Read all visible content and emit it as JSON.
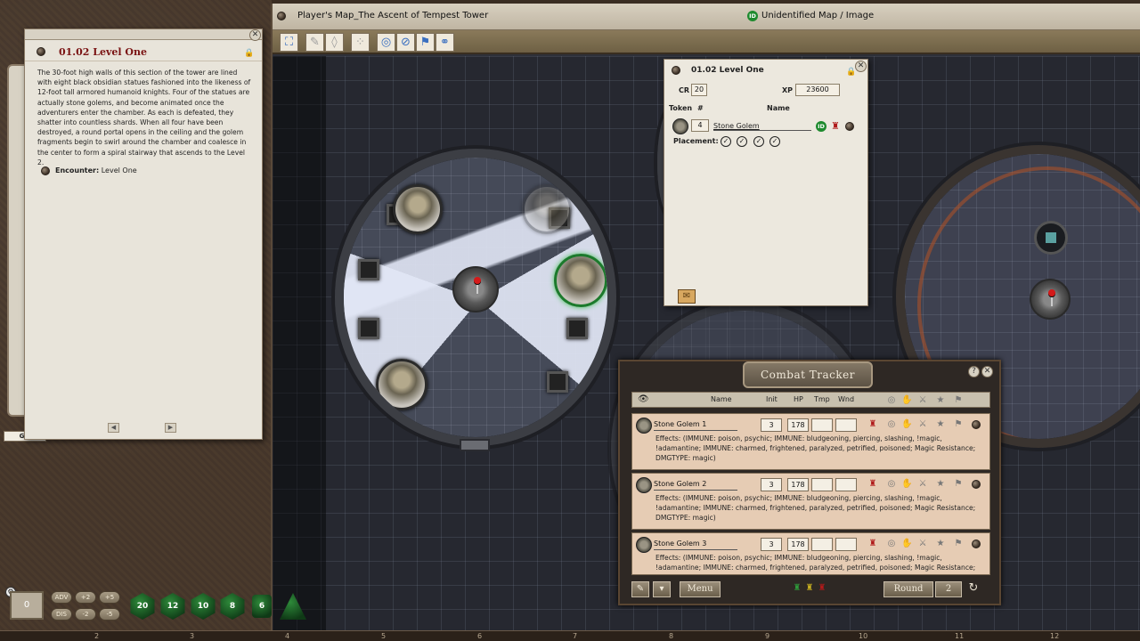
{
  "map_window": {
    "title": "Player's Map_The Ascent of Tempest Tower",
    "status": "Unidentified Map / Image"
  },
  "story": {
    "title": "01.02 Level One",
    "body": "The 30-foot high walls of this section of the tower are lined with eight black obsidian statues fashioned into the likeness of 12-foot tall armored humanoid knights. Four of the statues are actually stone golems, and become animated once the adventurers enter the chamber. As each is defeated, they shatter into countless shards. When all four have been destroyed, a round portal opens in the ceiling and the golem fragments begin to swirl around the chamber and coalesce in the center to form a spiral stairway that ascends to the Level 2.",
    "link_label": "Encounter:",
    "link_value": "Level One"
  },
  "side_tab": "GM",
  "encounter": {
    "title": "01.02 Level One",
    "cr_label": "CR",
    "cr": "20",
    "xp_label": "XP",
    "xp": "23600",
    "token_header": "Token",
    "count_header": "#",
    "name_header": "Name",
    "count": "4",
    "name": "Stone Golem",
    "placement_label": "Placement:"
  },
  "combat_tracker": {
    "title": "Combat Tracker",
    "headers": {
      "name": "Name",
      "init": "Init",
      "hp": "HP",
      "tmp": "Tmp",
      "wnd": "Wnd"
    },
    "rows": [
      {
        "name": "Stone Golem 1",
        "init": "3",
        "hp": "178",
        "effects": "Effects: (IMMUNE: poison, psychic; IMMUNE: bludgeoning, piercing, slashing, !magic, !adamantine; IMMUNE: charmed, frightened, paralyzed, petrified, poisoned; Magic Resistance; DMGTYPE: magic)"
      },
      {
        "name": "Stone Golem 2",
        "init": "3",
        "hp": "178",
        "effects": "Effects: (IMMUNE: poison, psychic; IMMUNE: bludgeoning, piercing, slashing, !magic, !adamantine; IMMUNE: charmed, frightened, paralyzed, petrified, poisoned; Magic Resistance; DMGTYPE: magic)"
      },
      {
        "name": "Stone Golem 3",
        "init": "3",
        "hp": "178",
        "effects": "Effects: (IMMUNE: poison, psychic; IMMUNE: bludgeoning, piercing, slashing, !magic, !adamantine; IMMUNE: charmed, frightened, paralyzed, petrified, poisoned; Magic Resistance; DMGTYPE: magic)"
      }
    ],
    "menu_label": "Menu",
    "round_label": "Round",
    "round_value": "2"
  },
  "hotbar": {
    "modifier": "0",
    "adv": "ADV",
    "dis": "DIS",
    "plus2": "+2",
    "plus5": "+5",
    "minus2": "-2",
    "minus5": "-5"
  },
  "dice": [
    "20",
    "12",
    "10",
    "8",
    "6"
  ],
  "ruler": [
    "2",
    "3",
    "4",
    "5",
    "6",
    "7",
    "8",
    "9",
    "10",
    "11",
    "12"
  ],
  "colors": {
    "story_title": "#7a1313",
    "selected_token": "#1c7a2c",
    "faction_red": "#b01a1a",
    "dice_green": "#1f6a2a"
  }
}
